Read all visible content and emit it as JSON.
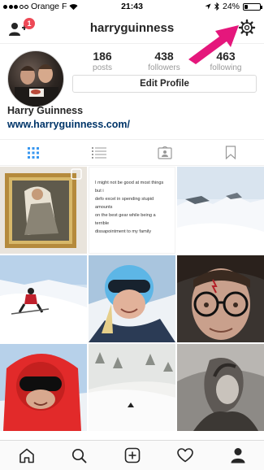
{
  "status_bar": {
    "carrier": "Orange F",
    "time": "21:43",
    "battery_percent": "24%",
    "battery_level": 0.24
  },
  "header": {
    "username": "harryguinness",
    "notification_count": "1",
    "icons": {
      "left": "add-user-icon",
      "right": "gear-icon"
    }
  },
  "profile": {
    "stats": [
      {
        "value": "186",
        "label": "posts"
      },
      {
        "value": "438",
        "label": "followers"
      },
      {
        "value": "463",
        "label": "following"
      }
    ],
    "edit_button": "Edit Profile",
    "name": "Harry Guinness",
    "website": "www.harryguinness.com/"
  },
  "view_tabs": [
    {
      "icon": "grid-icon",
      "active": true
    },
    {
      "icon": "list-icon",
      "active": false
    },
    {
      "icon": "tagged-photos-icon",
      "active": false
    },
    {
      "icon": "bookmark-icon",
      "active": false
    }
  ],
  "posts": {
    "text_post": [
      "I might not be good at most things but i",
      "defo excel in spending stupid amounts",
      "on the best gear while being a terrible",
      "dissapointment to my family"
    ]
  },
  "tab_bar": [
    {
      "icon": "home-icon"
    },
    {
      "icon": "search-icon"
    },
    {
      "icon": "new-post-icon"
    },
    {
      "icon": "heart-icon"
    },
    {
      "icon": "profile-icon",
      "active": true
    }
  ],
  "colors": {
    "accent_link": "#003569",
    "badge": "#ed4956",
    "annotation_arrow": "#e5177c",
    "active_tab": "#3897f0"
  }
}
